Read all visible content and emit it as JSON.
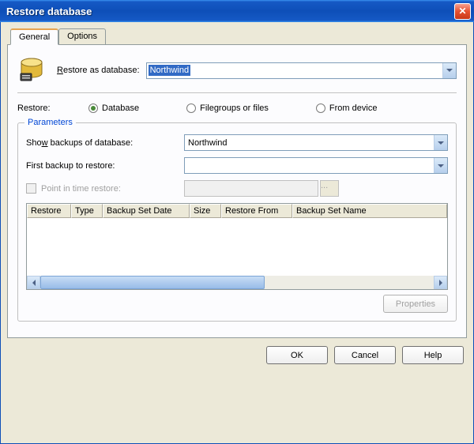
{
  "window": {
    "title": "Restore database"
  },
  "tabs": {
    "general": "General",
    "options": "Options"
  },
  "restore_as": {
    "label_pre": "R",
    "label_post": "estore as database:",
    "selected": "Northwind"
  },
  "restore": {
    "label": "Restore:",
    "opt_database": "Database",
    "opt_filegroups": "Filegroups or files",
    "opt_device": "From device"
  },
  "params": {
    "legend": "Parameters",
    "show_backups_pre": "Sho",
    "show_backups_u": "w",
    "show_backups_post": " backups of database:",
    "show_backups_value": "Northwind",
    "first_backup_label": "First backup to restore:",
    "first_backup_value": "",
    "point_in_time_label": "Point in time restore:",
    "columns": {
      "restore": "Restore",
      "type": "Type",
      "date": "Backup Set Date",
      "size": "Size",
      "from": "Restore From",
      "name": "Backup Set Name"
    },
    "properties_btn": "Properties"
  },
  "buttons": {
    "ok": "OK",
    "cancel": "Cancel",
    "help": "Help"
  }
}
